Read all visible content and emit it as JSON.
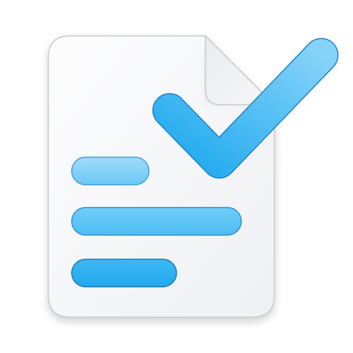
{
  "icon": {
    "name": "document-checklist-icon",
    "colors": {
      "page_light": "#fbfbfd",
      "page_dark": "#eeeff2",
      "page_border": "#c9ccd1",
      "accent_light": "#8fd6fa",
      "accent_dark": "#1aaaf0",
      "accent_border": "#1877b4"
    }
  }
}
